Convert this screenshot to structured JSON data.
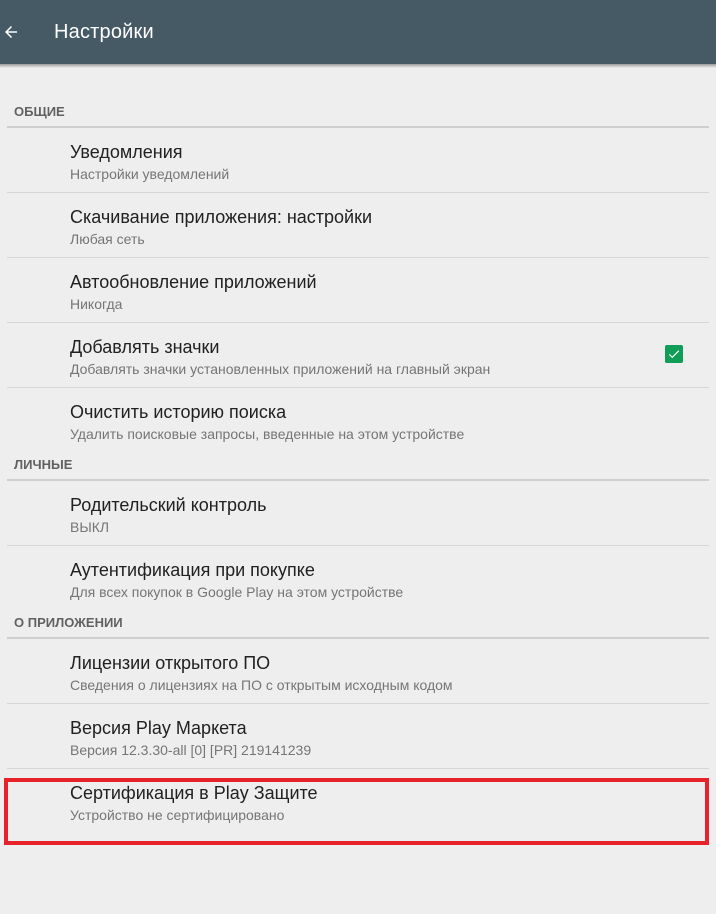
{
  "appbar": {
    "title": "Настройки",
    "background": "#455a64",
    "back_icon": "arrow-left-icon"
  },
  "sections": {
    "general": {
      "header": "ОБЩИЕ",
      "items": [
        {
          "title": "Уведомления",
          "subtitle": "Настройки уведомлений"
        },
        {
          "title": "Скачивание приложения: настройки",
          "subtitle": "Любая сеть"
        },
        {
          "title": "Автообновление приложений",
          "subtitle": "Никогда"
        },
        {
          "title": "Добавлять значки",
          "subtitle": "Добавлять значки установленных приложений на главный экран",
          "checked": true
        },
        {
          "title": "Очистить историю поиска",
          "subtitle": "Удалить поисковые запросы, введенные на этом устройстве"
        }
      ]
    },
    "personal": {
      "header": "ЛИЧНЫЕ",
      "items": [
        {
          "title": "Родительский контроль",
          "subtitle": "ВЫКЛ"
        },
        {
          "title": "Аутентификация при покупке",
          "subtitle": "Для всех покупок в Google Play на этом устройстве"
        }
      ]
    },
    "about": {
      "header": "О ПРИЛОЖЕНИИ",
      "items": [
        {
          "title": "Лицензии открытого ПО",
          "subtitle": "Сведения о лицензиях на ПО с открытым исходным кодом"
        },
        {
          "title": "Версия Play Маркета",
          "subtitle": "Версия 12.3.30-all [0] [PR] 219141239"
        },
        {
          "title": "Сертификация в Play Защите",
          "subtitle": "Устройство не сертифицировано"
        }
      ]
    }
  },
  "colors": {
    "checkbox": "#0f9d58",
    "highlight": "#e8222b"
  }
}
